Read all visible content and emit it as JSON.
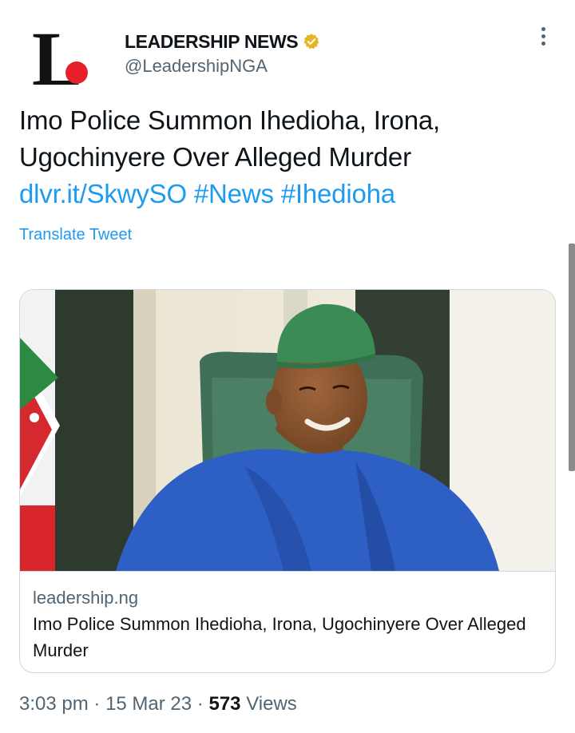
{
  "author": {
    "logo_letter": "L",
    "display_name": "LEADERSHIP NEWS",
    "handle": "@LeadershipNGA",
    "verified_icon": "verified-badge-icon",
    "verified_color": "#e8b325"
  },
  "tweet": {
    "text_line1": "Imo Police Summon Ihedioha, Irona,",
    "text_line2": "Ugochinyere Over Alleged Murder",
    "link": "dlvr.it/SkwySO",
    "hashtag1": "#News",
    "hashtag2": "#Ihedioha",
    "translate_label": "Translate Tweet"
  },
  "card": {
    "domain": "leadership.ng",
    "title": "Imo Police Summon Ihedioha, Irona, Ugochinyere Over Alleged Murder"
  },
  "meta": {
    "time": "3:03 pm",
    "separator": "·",
    "date": "15 Mar 23",
    "views_count": "573",
    "views_label": "Views"
  },
  "colors": {
    "link": "#1d9bf0",
    "secondary_text": "#536471",
    "border": "#cfd9de",
    "logo_dot": "#e5202a"
  }
}
